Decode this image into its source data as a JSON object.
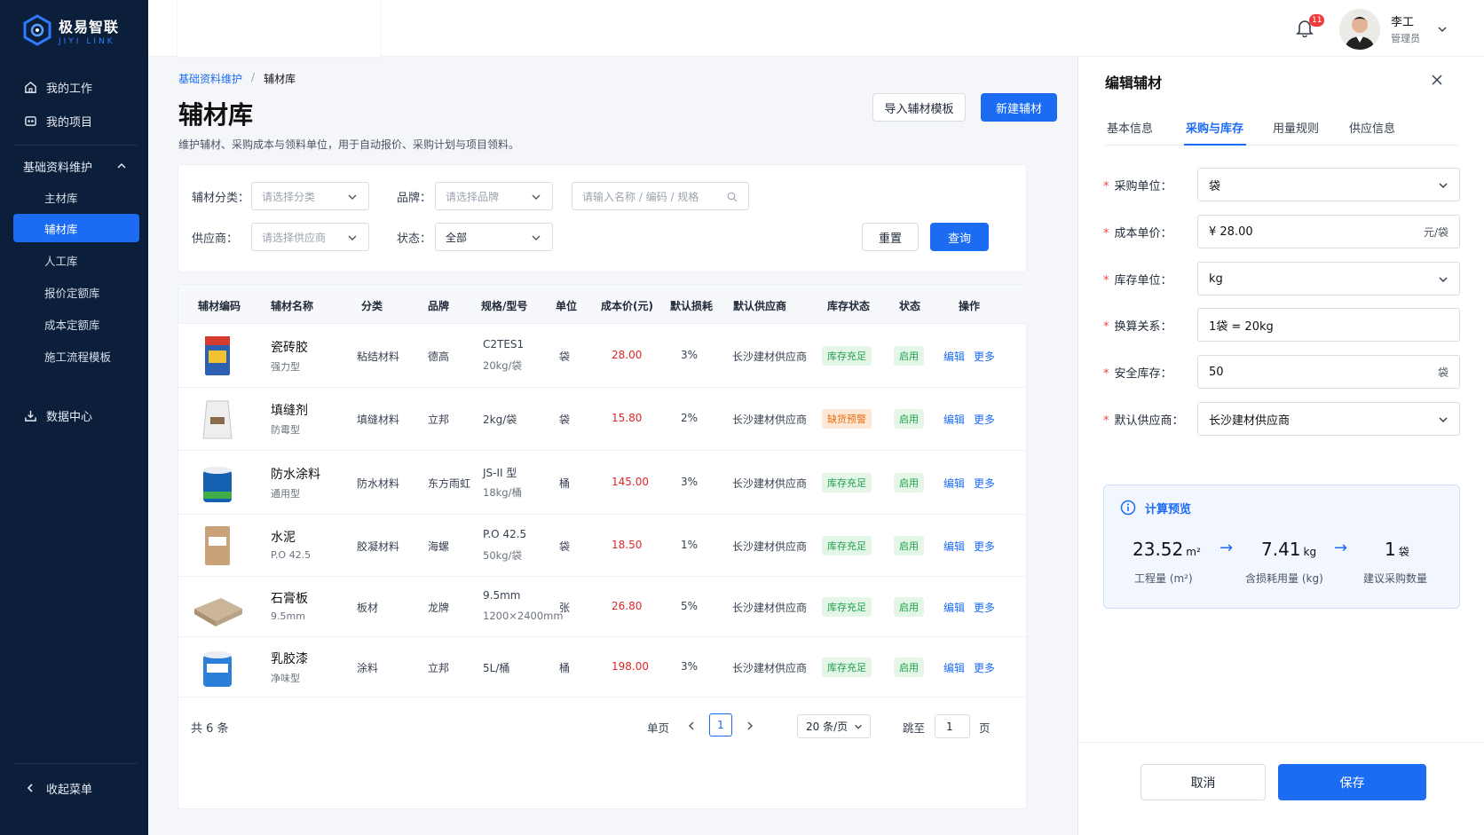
{
  "brand": {
    "name_cn": "极易智联",
    "name_en": "JIYI LINK"
  },
  "sidebar": {
    "top_items": [
      {
        "label": "我的工作",
        "icon": "home-icon"
      },
      {
        "label": "我的项目",
        "icon": "project-icon"
      }
    ],
    "group": {
      "label": "基础资料维护",
      "icon": "chevron-up-icon",
      "items": [
        "主材库",
        "辅材库",
        "人工库",
        "报价定额库",
        "成本定额库",
        "施工流程模板"
      ]
    },
    "data_center": {
      "label": "数据中心",
      "icon": "chart-icon"
    },
    "collapse": {
      "label": "收起菜单",
      "icon": "chevron-left-icon"
    }
  },
  "header": {
    "notification_count": "11",
    "user_name": "李工",
    "user_role": "管理员"
  },
  "breadcrumb": {
    "parent": "基础资料维护",
    "current": "辅材库"
  },
  "page": {
    "title": "辅材库",
    "description": "维护辅材、采购成本与领料单位，用于自动报价、采购计划与项目领料。",
    "import_button": "导入辅材模板",
    "new_button": "新建辅材"
  },
  "filters": {
    "category": {
      "label": "辅材分类：",
      "placeholder": "请选择分类"
    },
    "brand": {
      "label": "品牌：",
      "placeholder": "请选择品牌"
    },
    "search": {
      "placeholder": "请输入名称 / 编码 / 规格"
    },
    "supplier": {
      "label": "供应商：",
      "placeholder": "请选择供应商"
    },
    "status": {
      "label": "状态：",
      "value": "全部"
    },
    "reset": "重置",
    "query": "查询"
  },
  "table": {
    "columns": [
      "辅材编码",
      "辅材名称",
      "分类",
      "品牌",
      "规格/型号",
      "单位",
      "成本价(元)",
      "默认损耗",
      "默认供应商",
      "库存状态",
      "状态",
      "操作"
    ],
    "rows": [
      {
        "name": "瓷砖胶",
        "sub": "强力型",
        "category": "粘结材料",
        "brand": "德高",
        "spec1": "C2TES1",
        "spec2": "20kg/袋",
        "unit": "袋",
        "price": "28.00",
        "loss": "3%",
        "supplier": "长沙建材供应商",
        "stock": "库存充足",
        "stock_level": "ok",
        "status": "启用",
        "edit": "编辑",
        "more": "更多"
      },
      {
        "name": "填缝剂",
        "sub": "防霉型",
        "category": "填缝材料",
        "brand": "立邦",
        "spec1": "2kg/袋",
        "spec2": "",
        "unit": "袋",
        "price": "15.80",
        "loss": "2%",
        "supplier": "长沙建材供应商",
        "stock": "缺货预警",
        "stock_level": "warn",
        "status": "启用",
        "edit": "编辑",
        "more": "更多"
      },
      {
        "name": "防水涂料",
        "sub": "通用型",
        "category": "防水材料",
        "brand": "东方雨虹",
        "spec1": "JS-II 型",
        "spec2": "18kg/桶",
        "unit": "桶",
        "price": "145.00",
        "loss": "3%",
        "supplier": "长沙建材供应商",
        "stock": "库存充足",
        "stock_level": "ok",
        "status": "启用",
        "edit": "编辑",
        "more": "更多"
      },
      {
        "name": "水泥",
        "sub": "P.O 42.5",
        "category": "胶凝材料",
        "brand": "海螺",
        "spec1": "P.O 42.5",
        "spec2": "50kg/袋",
        "unit": "袋",
        "price": "18.50",
        "loss": "1%",
        "supplier": "长沙建材供应商",
        "stock": "库存充足",
        "stock_level": "ok",
        "status": "启用",
        "edit": "编辑",
        "more": "更多"
      },
      {
        "name": "石膏板",
        "sub": "9.5mm",
        "category": "板材",
        "brand": "龙牌",
        "spec1": "9.5mm",
        "spec2": "1200×2400mm",
        "unit": "张",
        "price": "26.80",
        "loss": "5%",
        "supplier": "长沙建材供应商",
        "stock": "库存充足",
        "stock_level": "ok",
        "status": "启用",
        "edit": "编辑",
        "more": "更多"
      },
      {
        "name": "乳胶漆",
        "sub": "净味型",
        "category": "涂料",
        "brand": "立邦",
        "spec1": "5L/桶",
        "spec2": "",
        "unit": "桶",
        "price": "198.00",
        "loss": "3%",
        "supplier": "长沙建材供应商",
        "stock": "库存充足",
        "stock_level": "ok",
        "status": "启用",
        "edit": "编辑",
        "more": "更多"
      }
    ]
  },
  "pagination": {
    "total": "共 6 条",
    "single_page": "单页",
    "current": "1",
    "page_size": "20 条/页",
    "goto_label": "跳至",
    "goto_value": "1",
    "page_suffix": "页"
  },
  "drawer": {
    "title": "编辑辅材",
    "tabs": [
      "基本信息",
      "采购与库存",
      "用量规则",
      "供应信息"
    ],
    "active_tab": "采购与库存",
    "fields": [
      {
        "label": "采购单位：",
        "value": "袋",
        "type": "select"
      },
      {
        "label": "成本单价：",
        "value": "¥ 28.00",
        "unit": "元/袋",
        "type": "input"
      },
      {
        "label": "库存单位：",
        "value": "kg",
        "type": "select"
      },
      {
        "label": "换算关系：",
        "value": "1袋 = 20kg",
        "type": "input"
      },
      {
        "label": "安全库存：",
        "value": "50",
        "unit": "袋",
        "type": "input"
      },
      {
        "label": "默认供应商：",
        "value": "长沙建材供应商",
        "type": "select"
      }
    ],
    "preview": {
      "title": "计算预览",
      "a_value": "23.52",
      "a_unit": "m²",
      "a_label": "工程量 (m²)",
      "b_value": "7.41",
      "b_unit": "kg",
      "b_label": "含损耗用量 (kg)",
      "c_value": "1",
      "c_unit": "袋",
      "c_label": "建议采购数量",
      "arrow": "→"
    },
    "cancel": "取消",
    "save": "保存"
  },
  "colors": {
    "primary": "#1c6cf3",
    "sidebar_bg": "#0b1e3a",
    "price_red": "#dc2626",
    "ok_green": "#1e9e4a",
    "warn_orange": "#ea6c12"
  }
}
